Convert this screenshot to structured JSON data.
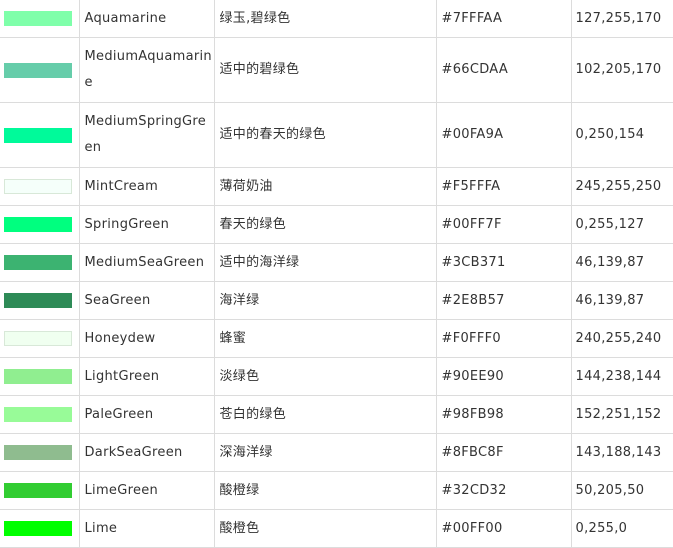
{
  "rows": [
    {
      "name": "Aquamarine",
      "cn": "绿玉,碧绿色",
      "hex": "#7FFFAA",
      "rgb": "127,255,170",
      "swatch": "#7FFFAA"
    },
    {
      "name": "MediumAquamarine",
      "cn": "适中的碧绿色",
      "hex": "#66CDAA",
      "rgb": "102,205,170",
      "swatch": "#66CDAA"
    },
    {
      "name": "MediumSpringGreen",
      "cn": "适中的春天的绿色",
      "hex": "#00FA9A",
      "rgb": "0,250,154",
      "swatch": "#00FA9A"
    },
    {
      "name": "MintCream",
      "cn": "薄荷奶油",
      "hex": "#F5FFFA",
      "rgb": "245,255,250",
      "swatch": "#F5FFFA"
    },
    {
      "name": "SpringGreen",
      "cn": "春天的绿色",
      "hex": "#00FF7F",
      "rgb": "0,255,127",
      "swatch": "#00FF7F"
    },
    {
      "name": "MediumSeaGreen",
      "cn": "适中的海洋绿",
      "hex": "#3CB371",
      "rgb": "46,139,87",
      "swatch": "#3CB371"
    },
    {
      "name": "SeaGreen",
      "cn": "海洋绿",
      "hex": "#2E8B57",
      "rgb": "46,139,87",
      "swatch": "#2E8B57"
    },
    {
      "name": "Honeydew",
      "cn": "蜂蜜",
      "hex": "#F0FFF0",
      "rgb": "240,255,240",
      "swatch": "#F0FFF0"
    },
    {
      "name": "LightGreen",
      "cn": "淡绿色",
      "hex": "#90EE90",
      "rgb": "144,238,144",
      "swatch": "#90EE90"
    },
    {
      "name": "PaleGreen",
      "cn": "苍白的绿色",
      "hex": "#98FB98",
      "rgb": "152,251,152",
      "swatch": "#98FB98"
    },
    {
      "name": "DarkSeaGreen",
      "cn": "深海洋绿",
      "hex": "#8FBC8F",
      "rgb": "143,188,143",
      "swatch": "#8FBC8F"
    },
    {
      "name": "LimeGreen",
      "cn": "酸橙绿",
      "hex": "#32CD32",
      "rgb": "50,205,50",
      "swatch": "#32CD32"
    },
    {
      "name": "Lime",
      "cn": "酸橙色",
      "hex": "#00FF00",
      "rgb": "0,255,0",
      "swatch": "#00FF00"
    }
  ]
}
